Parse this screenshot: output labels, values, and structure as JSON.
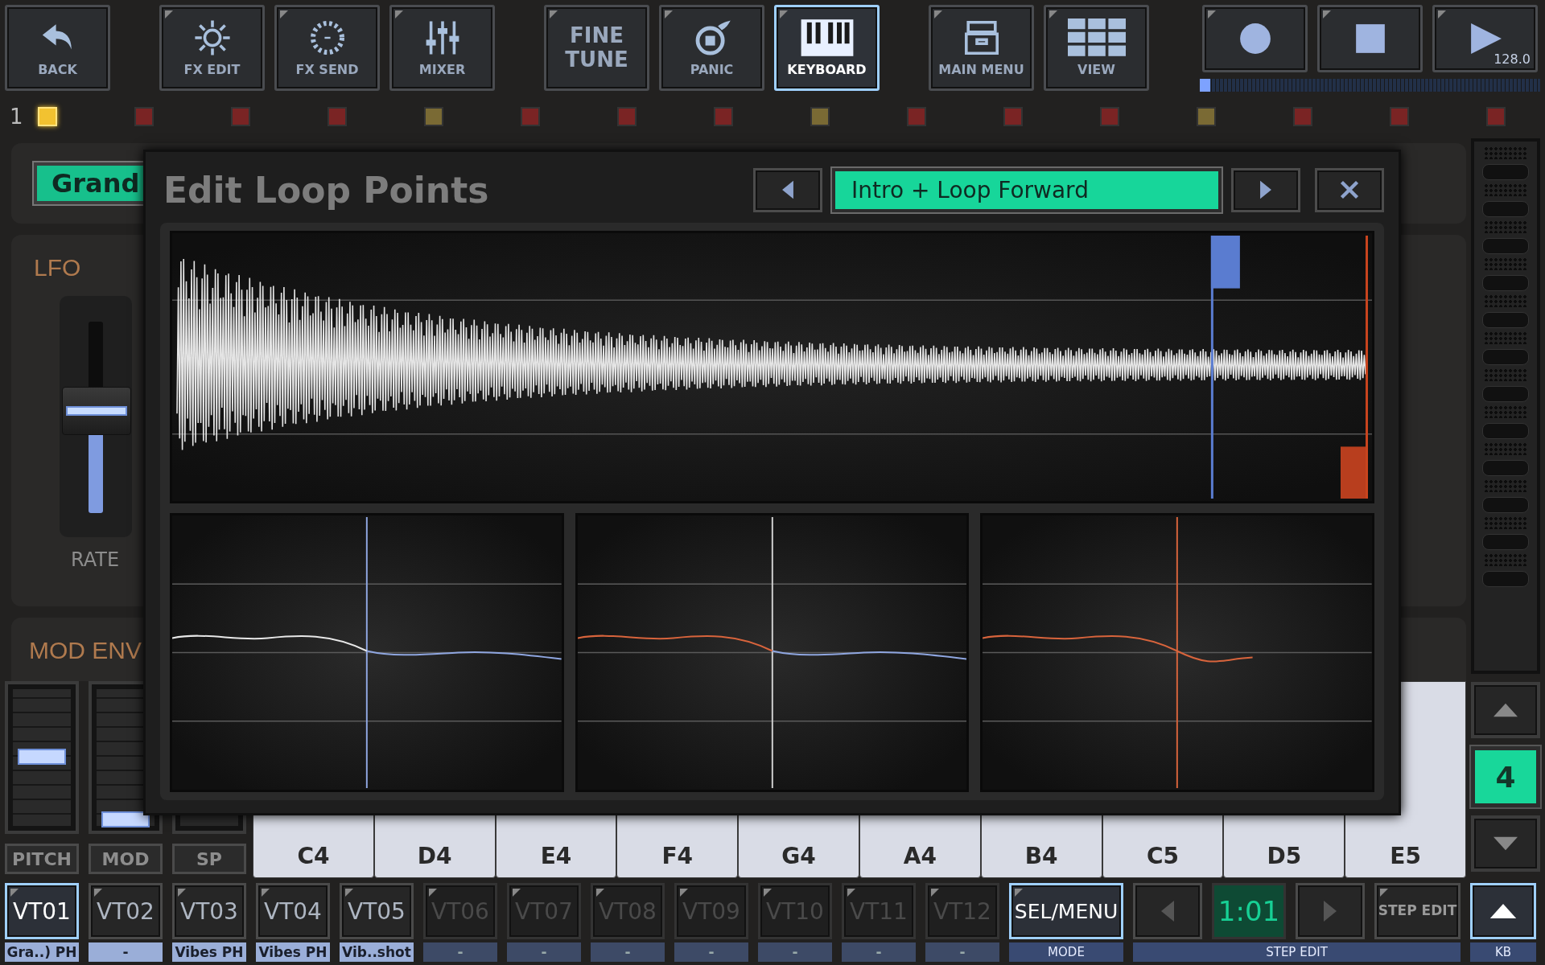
{
  "toolbar": {
    "groups": [
      [
        {
          "label": "BACK",
          "kind": "back",
          "selected": false
        }
      ],
      [
        {
          "label": "FX EDIT",
          "kind": "fxedit",
          "selected": false
        },
        {
          "label": "FX SEND",
          "kind": "fxsend",
          "selected": false
        },
        {
          "label": "MIXER",
          "kind": "mixer",
          "selected": false
        }
      ],
      [
        {
          "label": "FINE TUNE",
          "kind": "text",
          "selected": false
        },
        {
          "label": "PANIC",
          "kind": "panic",
          "selected": false
        },
        {
          "label": "KEYBOARD",
          "kind": "keyboard",
          "selected": true
        }
      ],
      [
        {
          "label": "MAIN MENU",
          "kind": "menu",
          "selected": false
        },
        {
          "label": "VIEW",
          "kind": "view",
          "selected": false
        }
      ]
    ]
  },
  "transport": {
    "buttons": [
      {
        "kind": "record"
      },
      {
        "kind": "stop"
      },
      {
        "kind": "play",
        "value": "128.0"
      }
    ],
    "position": {
      "level": 0.03
    }
  },
  "track_row": {
    "label": "1",
    "tracks": [
      {
        "color": "#f2c230",
        "selected": true
      },
      {
        "color": "#7a2424",
        "selected": false
      },
      {
        "color": "#7a2424",
        "selected": false
      },
      {
        "color": "#7a2424",
        "selected": false
      },
      {
        "color": "#7a6a34",
        "selected": false
      },
      {
        "color": "#7a2424",
        "selected": false
      },
      {
        "color": "#7a2424",
        "selected": false
      },
      {
        "color": "#7a2424",
        "selected": false
      },
      {
        "color": "#7a6a34",
        "selected": false
      },
      {
        "color": "#7a2424",
        "selected": false
      },
      {
        "color": "#7a2424",
        "selected": false
      },
      {
        "color": "#7a2424",
        "selected": false
      },
      {
        "color": "#7a6a34",
        "selected": false
      },
      {
        "color": "#7a2424",
        "selected": false
      },
      {
        "color": "#7a2424",
        "selected": false
      },
      {
        "color": "#7a2424",
        "selected": false
      }
    ]
  },
  "preset": {
    "label": "Grand"
  },
  "lfo": {
    "title": "LFO",
    "fader": {
      "label": "RATE",
      "level": 0.5
    }
  },
  "mod_env": {
    "title": "MOD ENV"
  },
  "wheels": [
    {
      "label": "PITCH",
      "level": 0.5
    },
    {
      "label": "MOD",
      "level": 0.0
    },
    {
      "label": "SP"
    }
  ],
  "keyboard": {
    "keys": [
      "C4",
      "D4",
      "E4",
      "F4",
      "G4",
      "A4",
      "B4",
      "C5",
      "D5",
      "E5"
    ],
    "octave": "4"
  },
  "voices": [
    {
      "label": "VT01",
      "sublabel": "Gra..) PH",
      "selected": true,
      "disabled": false
    },
    {
      "label": "VT02",
      "sublabel": "-",
      "selected": false,
      "disabled": false
    },
    {
      "label": "VT03",
      "sublabel": "Vibes PH",
      "selected": false,
      "disabled": false
    },
    {
      "label": "VT04",
      "sublabel": "Vibes PH",
      "selected": false,
      "disabled": false
    },
    {
      "label": "VT05",
      "sublabel": "Vib..shot",
      "selected": false,
      "disabled": false
    },
    {
      "label": "VT06",
      "sublabel": "-",
      "selected": false,
      "disabled": true
    },
    {
      "label": "VT07",
      "sublabel": "-",
      "selected": false,
      "disabled": true
    },
    {
      "label": "VT08",
      "sublabel": "-",
      "selected": false,
      "disabled": true
    },
    {
      "label": "VT09",
      "sublabel": "-",
      "selected": false,
      "disabled": true
    },
    {
      "label": "VT10",
      "sublabel": "-",
      "selected": false,
      "disabled": true
    },
    {
      "label": "VT11",
      "sublabel": "-",
      "selected": false,
      "disabled": true
    },
    {
      "label": "VT12",
      "sublabel": "-",
      "selected": false,
      "disabled": true
    }
  ],
  "sel_menu": {
    "label": "SEL/MENU",
    "selected": true,
    "caption": "MODE"
  },
  "step": {
    "position": "1:01",
    "edit_label": "STEP EDIT",
    "caption": "STEP EDIT"
  },
  "kb": {
    "selected": true,
    "caption": "KB"
  },
  "dialog": {
    "title": "Edit Loop Points",
    "mode": "Intro + Loop Forward"
  }
}
